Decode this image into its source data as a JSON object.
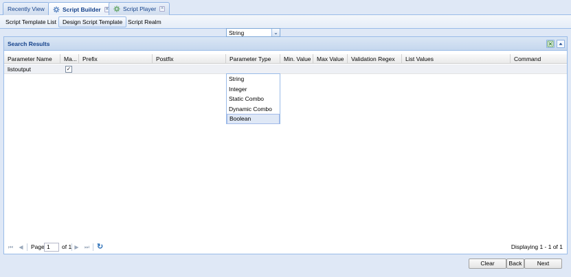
{
  "top_tabs": [
    {
      "label": "Recently View",
      "icon": "none",
      "active": false
    },
    {
      "label": "Script Builder",
      "icon": "gear-icon",
      "active": true,
      "closable": true
    },
    {
      "label": "Script Player",
      "icon": "gear-icon",
      "active": false,
      "closable": true
    }
  ],
  "close_glyph": "×",
  "sub_tabs": [
    {
      "label": "Script Template List",
      "active": false
    },
    {
      "label": "Design Script Template",
      "active": true
    },
    {
      "label": "Script Realm",
      "active": false
    }
  ],
  "panel": {
    "title": "Search Results"
  },
  "grid": {
    "columns": [
      "Parameter Name",
      "Ma...",
      "Prefix",
      "Postfix",
      "Parameter Type",
      "Min. Value",
      "Max Value",
      "Validation Regex",
      "List Values",
      "Command"
    ],
    "rows": [
      {
        "parameter_name": "listoutput",
        "mandatory_checked": true,
        "check_glyph": "✓",
        "prefix": "",
        "postfix": "",
        "parameter_type": "String",
        "min_value": "",
        "max_value": "",
        "validation_regex": "",
        "list_values": "",
        "command": ""
      }
    ]
  },
  "combo": {
    "value": "String",
    "trigger_glyph": "⌄"
  },
  "dropdown_options": [
    "String",
    "Integer",
    "Static Combo",
    "Dynamic Combo",
    "Boolean"
  ],
  "dropdown_selected": "Boolean",
  "pager": {
    "page_label": "Page",
    "page_value": "1",
    "of_label": "of 1",
    "display_msg": "Displaying 1 - 1 of 1",
    "first_glyph": "⏮",
    "prev_glyph": "◀",
    "next_glyph": "▶",
    "last_glyph": "⏭",
    "refresh_glyph": "↻"
  },
  "footer_buttons": {
    "clear": "Clear",
    "back": "Back",
    "next": "Next"
  },
  "colors": {
    "accent": "#15428b",
    "border": "#99bbe8",
    "bg": "#dfe8f6"
  }
}
